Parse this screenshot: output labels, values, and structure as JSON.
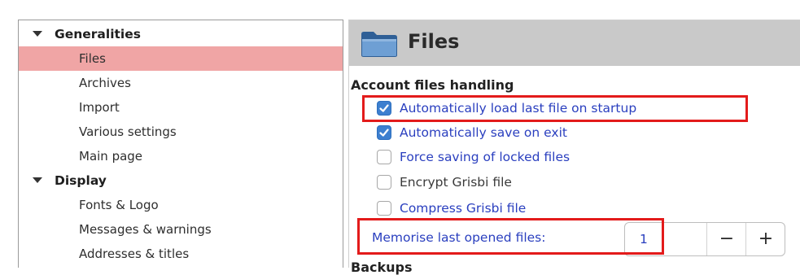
{
  "sidebar": {
    "groups": [
      {
        "label": "Generalities",
        "items": [
          "Files",
          "Archives",
          "Import",
          "Various settings",
          "Main page"
        ]
      },
      {
        "label": "Display",
        "items": [
          "Fonts & Logo",
          "Messages & warnings",
          "Addresses & titles"
        ]
      }
    ],
    "selected": "Files"
  },
  "page": {
    "title": "Files",
    "icon": "folder-icon",
    "section_title": "Account files handling",
    "options": [
      {
        "label": "Automatically load last file on startup",
        "checked": true
      },
      {
        "label": "Automatically save on exit",
        "checked": true
      },
      {
        "label": "Force saving of locked files",
        "checked": false
      },
      {
        "label": "Encrypt Grisbi file",
        "checked": false
      },
      {
        "label": "Compress Grisbi file",
        "checked": false
      }
    ],
    "memorise_label": "Memorise last opened files:",
    "memorise_value": "1",
    "minus": "−",
    "plus": "+",
    "next_section": "Backups"
  },
  "colors": {
    "selection": "#f0a5a5",
    "checkbox_on": "#3d7fcf",
    "highlight": "#e31b1b",
    "link_text": "#2a3fbf"
  }
}
